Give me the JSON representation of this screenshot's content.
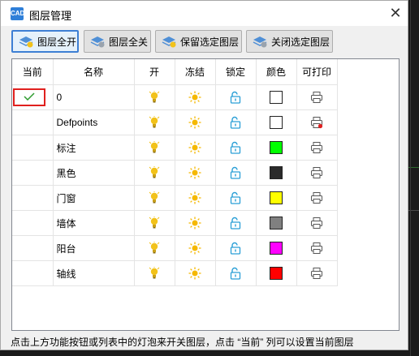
{
  "window": {
    "title": "图层管理",
    "app_icon_text": "CAD",
    "close_glyph": "✕"
  },
  "toolbar": {
    "buttons": [
      {
        "label": "图层全开"
      },
      {
        "label": "图层全关"
      },
      {
        "label": "保留选定图层"
      },
      {
        "label": "关闭选定图层"
      }
    ]
  },
  "table": {
    "headers": [
      "当前",
      "名称",
      "开",
      "冻结",
      "锁定",
      "颜色",
      "可打印"
    ],
    "rows": [
      {
        "current": true,
        "name": "0",
        "color": "#ffffff",
        "printable_error": false
      },
      {
        "current": false,
        "name": "Defpoints",
        "color": "#ffffff",
        "printable_error": true
      },
      {
        "current": false,
        "name": "标注",
        "color": "#00ff00",
        "printable_error": false
      },
      {
        "current": false,
        "name": "黑色",
        "color": "#2b2b2b",
        "printable_error": false
      },
      {
        "current": false,
        "name": "门窗",
        "color": "#ffff00",
        "printable_error": false
      },
      {
        "current": false,
        "name": "墙体",
        "color": "#808080",
        "printable_error": false
      },
      {
        "current": false,
        "name": "阳台",
        "color": "#ff00ff",
        "printable_error": false
      },
      {
        "current": false,
        "name": "轴线",
        "color": "#ff0000",
        "printable_error": false
      }
    ],
    "icons": {
      "on": "lightbulb-icon",
      "freeze": "sun-icon",
      "lock": "unlocked-padlock-icon",
      "print": "printer-icon"
    },
    "accent": {
      "check": "#2e9b2e",
      "current_highlight": "#e0201e",
      "bulb": "#f2c21a",
      "sun": "#f5b800",
      "lock": "#2a9fd6"
    }
  },
  "status": {
    "text": "点击上方功能按钮或列表中的灯泡来开关图层，点击 “当前” 列可以设置当前图层"
  }
}
